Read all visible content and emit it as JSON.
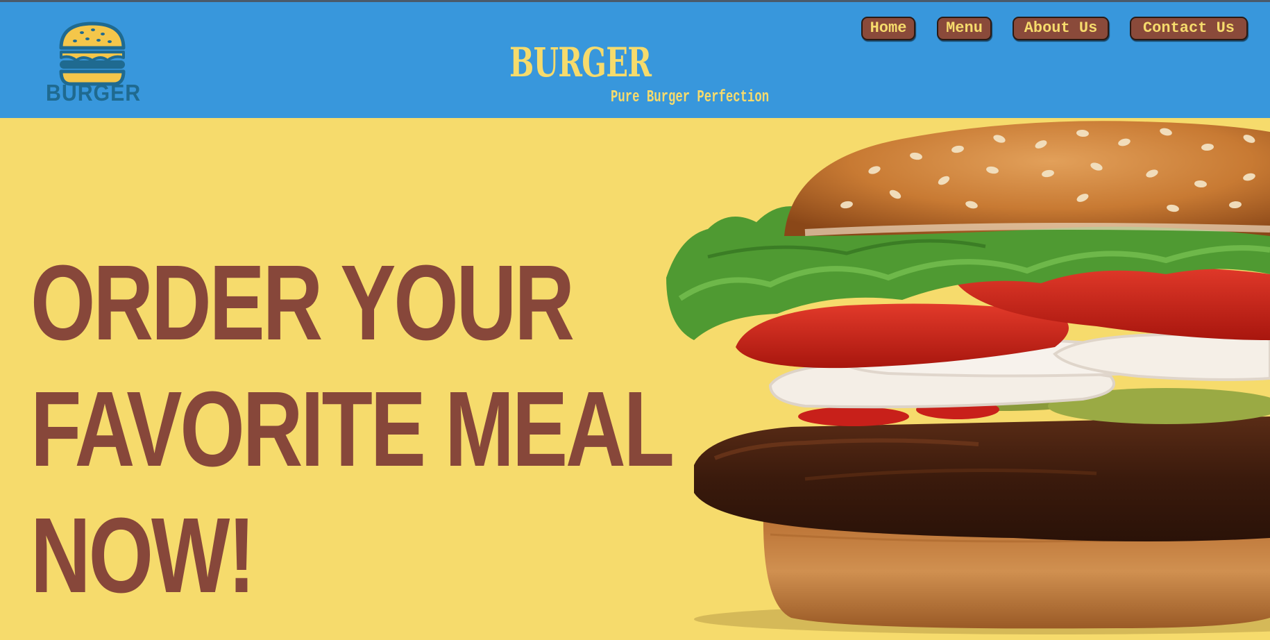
{
  "header": {
    "logo_text": "BURGER",
    "title": "BURGER",
    "tagline": "Pure Burger Perfection",
    "background_color": "#3897dc",
    "accent_color": "#f6db6c"
  },
  "nav": {
    "items": [
      {
        "label": "Home"
      },
      {
        "label": "Menu"
      },
      {
        "label": "About Us"
      },
      {
        "label": "Contact Us"
      }
    ],
    "button_color": "#8a4a3a"
  },
  "hero": {
    "headline_lines": [
      "ORDER YOUR",
      "FAVORITE MEAL",
      "NOW!"
    ],
    "headline_color": "#87473a",
    "background_color": "#f6db6c",
    "image_icon": "burger-photo"
  }
}
